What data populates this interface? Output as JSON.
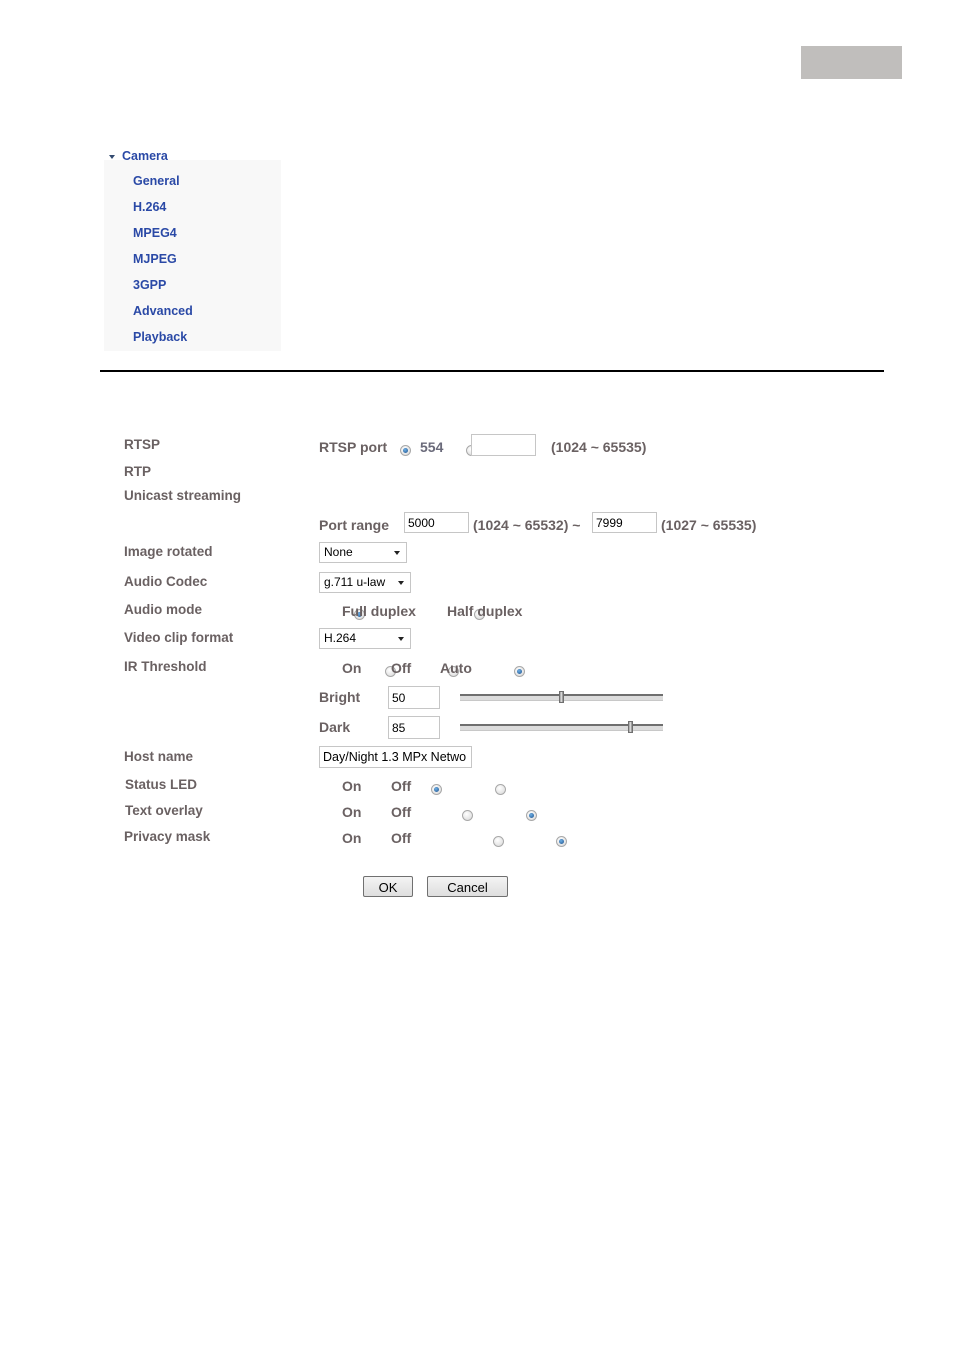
{
  "sidebar": {
    "section": "Camera",
    "items": [
      {
        "label": "General"
      },
      {
        "label": "H.264"
      },
      {
        "label": "MPEG4"
      },
      {
        "label": "MJPEG"
      },
      {
        "label": "3GPP"
      },
      {
        "label": "Advanced"
      },
      {
        "label": "Playback"
      }
    ]
  },
  "form": {
    "rtsp": {
      "label": "RTSP",
      "port_label": "RTSP port",
      "default_port": "554",
      "custom_port_value": "",
      "range": "(1024 ~ 65535)",
      "selected": "default"
    },
    "rtp": {
      "label": "RTP"
    },
    "unicast": {
      "label": "Unicast streaming",
      "port_range_label": "Port range",
      "start_value": "5000",
      "start_range": "(1024 ~ 65532) ~",
      "end_value": "7999",
      "end_range": "(1027 ~ 65535)"
    },
    "image_rotated": {
      "label": "Image rotated",
      "value": "None"
    },
    "audio_codec": {
      "label": "Audio Codec",
      "value": "g.711 u-law"
    },
    "audio_mode": {
      "label": "Audio mode",
      "options": [
        "Full duplex",
        "Half duplex"
      ],
      "selected": "Full duplex"
    },
    "video_clip_format": {
      "label": "Video clip format",
      "value": "H.264"
    },
    "ir_threshold": {
      "label": "IR Threshold",
      "options": [
        "On",
        "Off",
        "Auto"
      ],
      "selected": "Auto",
      "bright_label": "Bright",
      "bright_value": "50",
      "bright_slider_percent": 50,
      "dark_label": "Dark",
      "dark_value": "85",
      "dark_slider_percent": 85
    },
    "host_name": {
      "label": "Host name",
      "value": "Day/Night 1.3 MPx Netwo"
    },
    "status_led": {
      "label": "Status LED",
      "options": [
        "On",
        "Off"
      ],
      "selected": "On"
    },
    "text_overlay": {
      "label": "Text overlay",
      "options": [
        "On",
        "Off"
      ],
      "selected": "Off"
    },
    "privacy_mask": {
      "label": "Privacy mask",
      "options": [
        "On",
        "Off"
      ],
      "selected": "Off"
    }
  },
  "buttons": {
    "ok": "OK",
    "cancel": "Cancel"
  },
  "colors": {
    "nav_link": "#2a49a6",
    "label_text": "#6a6162",
    "radio_selected": "#1b4f8a",
    "corner_tab": "#c0bebc"
  }
}
